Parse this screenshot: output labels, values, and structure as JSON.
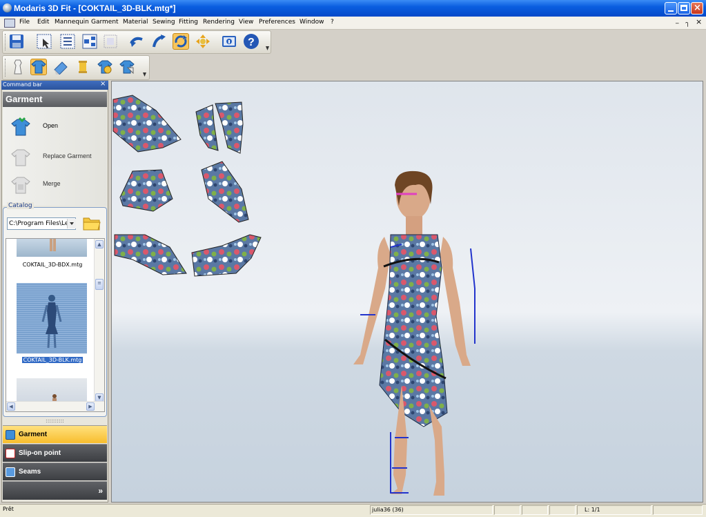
{
  "window": {
    "title": "Modaris 3D Fit - [COKTAIL_3D-BLK.mtg*]",
    "controls": [
      "minimize-icon",
      "maximize-icon",
      "close-icon"
    ]
  },
  "menu": {
    "items": [
      "File",
      "Edit",
      "Mannequin",
      "Garment",
      "Material",
      "Sewing",
      "Fitting",
      "Rendering",
      "View",
      "Preferences",
      "Window",
      "?"
    ],
    "mdi_controls": [
      "_",
      "ๅ",
      "×"
    ]
  },
  "toolbar1": {
    "buttons": [
      "save-icon",
      "select-icon",
      "select-all-icon",
      "hierarchy-icon",
      "frame-select-icon",
      "rotate-left-icon",
      "rotate-right-icon",
      "refresh-icon",
      "move-icon",
      "info-icon",
      "help-icon"
    ]
  },
  "toolbar2": {
    "buttons": [
      "mannequin-icon",
      "garment-icon",
      "eraser-icon",
      "thread-icon",
      "sew-garment-icon",
      "tag-garment-icon"
    ]
  },
  "command_bar": {
    "title": "Command bar",
    "section": "Garment",
    "commands": [
      {
        "label": "Open",
        "enabled": true
      },
      {
        "label": "Replace Garment",
        "enabled": false
      },
      {
        "label": "Merge",
        "enabled": false
      }
    ]
  },
  "catalog": {
    "legend": "Catalog",
    "path": "C:\\Program Files\\Le",
    "items": [
      {
        "label": "COKTAIL_3D-BDX.mtg",
        "selected": false
      },
      {
        "label": "COKTAIL_3D-BLK.mtg",
        "selected": true
      },
      {
        "label": "",
        "selected": false
      }
    ]
  },
  "panel_nav": {
    "items": [
      {
        "label": "Garment",
        "active": true
      },
      {
        "label": "Slip-on point",
        "active": false
      },
      {
        "label": "Seams",
        "active": false
      }
    ],
    "more": "»"
  },
  "status": {
    "left": "Prêt",
    "mannequin": "julia36 (36)",
    "layer": "L: 1/1"
  },
  "colors": {
    "title_bar": "#0a5ee0",
    "active_nav": "#f7bd2d",
    "selection": "#316ac5"
  }
}
